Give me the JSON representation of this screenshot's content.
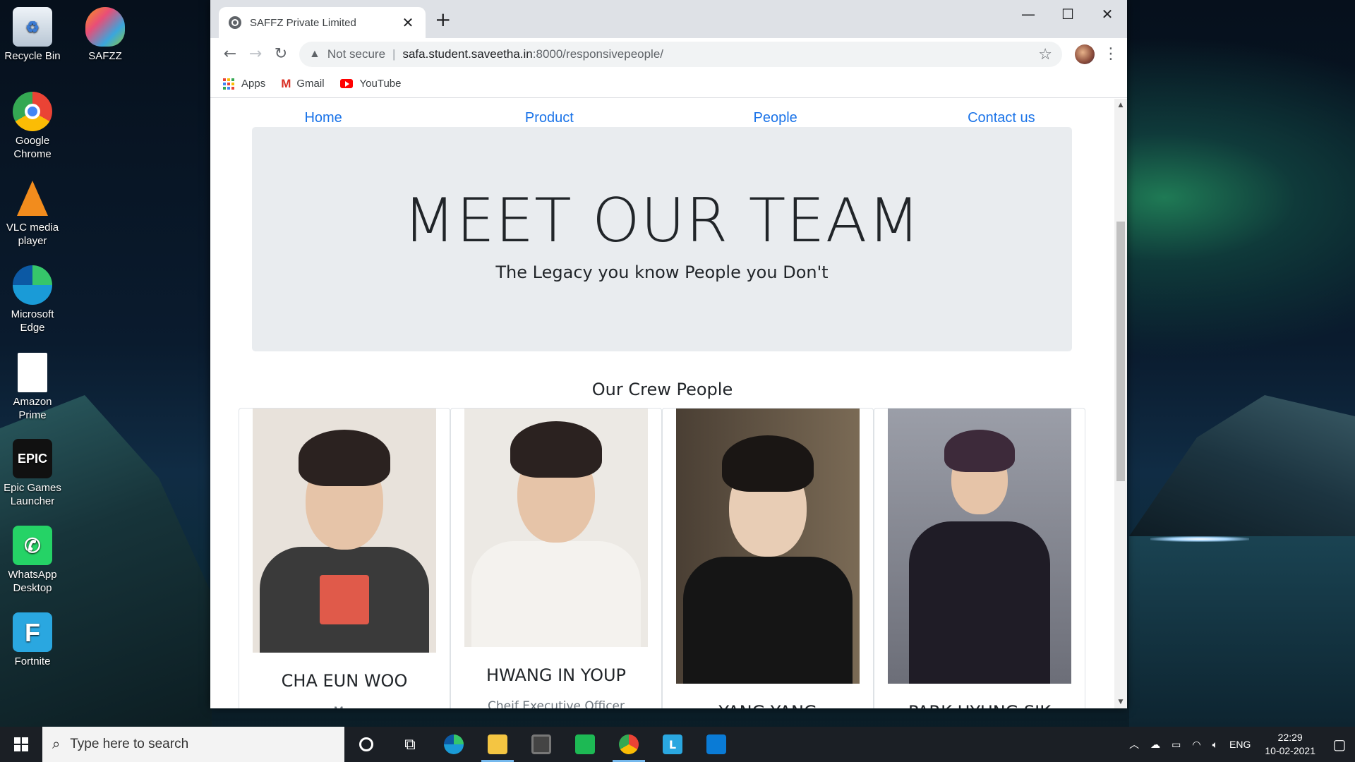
{
  "desktop": {
    "icons": [
      {
        "label": "Recycle Bin",
        "icon": "recycle-bin-icon"
      },
      {
        "label": "SAFZZ",
        "icon": "safzz-butterfly-icon"
      },
      {
        "label": "Google Chrome",
        "icon": "chrome-icon"
      },
      {
        "label": "VLC media player",
        "icon": "vlc-icon"
      },
      {
        "label": "Microsoft Edge",
        "icon": "edge-icon"
      },
      {
        "label": "Amazon Prime",
        "icon": "file-icon"
      },
      {
        "label": "Epic Games Launcher",
        "icon": "epic-games-icon"
      },
      {
        "label": "WhatsApp Desktop",
        "icon": "whatsapp-icon"
      },
      {
        "label": "Fortnite",
        "icon": "fortnite-icon"
      }
    ]
  },
  "browser": {
    "tab_title": "SAFFZ Private Limited",
    "security_label": "Not secure",
    "url_host": "safa.student.saveetha.in",
    "url_path": ":8000/responsivepeople/",
    "bookmarks": [
      {
        "label": "Apps",
        "icon": "apps-grid-icon"
      },
      {
        "label": "Gmail",
        "icon": "gmail-icon"
      },
      {
        "label": "YouTube",
        "icon": "youtube-icon"
      }
    ]
  },
  "site": {
    "nav": [
      "Home",
      "Product",
      "People",
      "Contact us"
    ],
    "hero_title": "MEET OUR TEAM",
    "hero_subtitle": "The Legacy you know People you Don't",
    "crew_heading": "Our Crew People",
    "people": [
      {
        "name": "CHA EUN WOO",
        "role": "M..."
      },
      {
        "name": "HWANG IN YOUP",
        "role": "Cheif Executive Officer"
      },
      {
        "name": "YANG YANG",
        "role": ""
      },
      {
        "name": "PARK HYUNG SIK",
        "role": ""
      }
    ]
  },
  "taskbar": {
    "search_placeholder": "Type here to search",
    "language": "ENG",
    "time": "22:29",
    "date": "10-02-2021"
  },
  "colors": {
    "link": "#1a73e8",
    "jumbotron": "#e9ecef",
    "taskbar": "#1b1f25"
  }
}
